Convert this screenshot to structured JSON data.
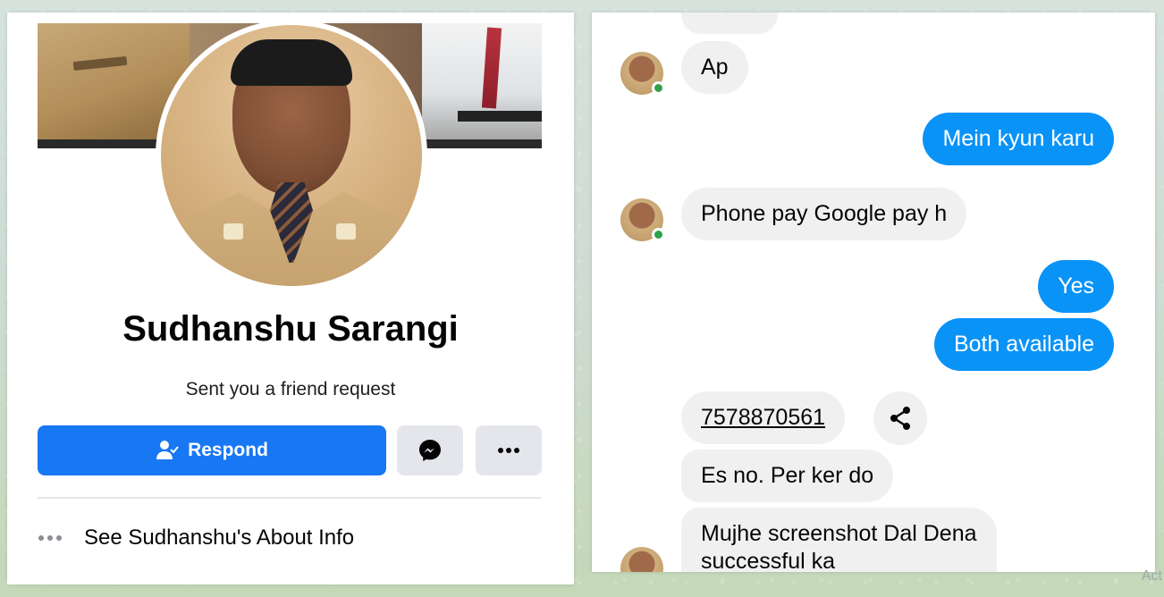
{
  "profile": {
    "name": "Sudhanshu Sarangi",
    "subtitle": "Sent you a friend request",
    "respond_label": "Respond",
    "about_label": "See Sudhanshu's About Info",
    "accent_color": "#1877f2"
  },
  "chat": {
    "messages": [
      {
        "direction": "incoming",
        "text": "Ap"
      },
      {
        "direction": "outgoing",
        "text": "Mein kyun karu"
      },
      {
        "direction": "incoming",
        "text": "Phone pay Google pay h"
      },
      {
        "direction": "outgoing",
        "text": "Yes"
      },
      {
        "direction": "outgoing",
        "text": "Both available"
      },
      {
        "direction": "incoming",
        "text": "7578870561"
      },
      {
        "direction": "incoming",
        "text": "Es no. Per ker do"
      },
      {
        "direction": "incoming",
        "text": "Mujhe screenshot Dal Dena"
      },
      {
        "direction": "incoming",
        "text": "successful ka"
      }
    ],
    "outgoing_color": "#0a93f7",
    "incoming_color": "#f0f0f0"
  },
  "watermark": "Act"
}
